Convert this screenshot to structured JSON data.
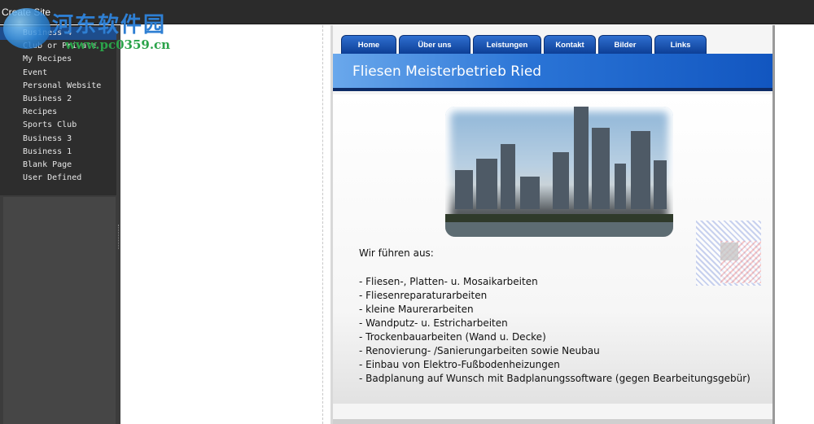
{
  "window": {
    "title": "Create Site"
  },
  "watermark": {
    "text": "河东软件园",
    "url": "www.pc0359.cn"
  },
  "sidebar": {
    "items": [
      {
        "label": "Business 4",
        "selected": true
      },
      {
        "label": "Club or Private"
      },
      {
        "label": "My Recipes"
      },
      {
        "label": "Event"
      },
      {
        "label": "Personal Website"
      },
      {
        "label": "Business 2"
      },
      {
        "label": "Recipes"
      },
      {
        "label": "Sports Club"
      },
      {
        "label": "Business 3"
      },
      {
        "label": "Business 1"
      },
      {
        "label": "Blank Page"
      },
      {
        "label": "User Defined"
      }
    ]
  },
  "preview": {
    "nav": [
      "Home",
      "Über uns",
      "Leistungen",
      "Kontakt",
      "Bilder",
      "Links"
    ],
    "banner_title": "Fliesen Meisterbetrieb Ried",
    "lead": "Wir führen aus:",
    "services": [
      "- Fliesen-, Platten- u. Mosaikarbeiten",
      "- Fliesenreparaturarbeiten",
      "- kleine Maurerarbeiten",
      "- Wandputz- u. Estricharbeiten",
      "- Trockenbauarbeiten (Wand u. Decke)",
      "- Renovierung- /Sanierungarbeiten sowie Neubau",
      "- Einbau von Elektro-Fußbodenheizungen",
      "- Badplanung auf Wunsch mit Badplanungssoftware (gegen Bearbeitungsgebür)"
    ]
  },
  "colors": {
    "accent": "#1256c0",
    "nav_tab": "#0d3f96",
    "sidebar_bg": "#2d2d2d"
  }
}
